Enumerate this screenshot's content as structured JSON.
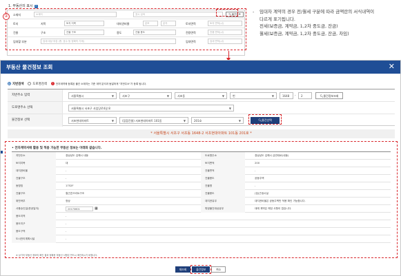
{
  "top_section": {
    "title": "1. 부동산의 표시",
    "help_badge": "?",
    "step_number": "②",
    "rows": [
      {
        "label": "소재지",
        "inputs": [
          "소재지",
          "",
          "표시 검색"
        ],
        "button": "물건정보"
      },
      {
        "label": "토지",
        "sub1": "지목",
        "sel1": "토지 지목",
        "sub2": "대지권비율",
        "inp2a": "분모",
        "inp2b": "분자",
        "sub3": "토지면적",
        "inp3": "토지 면적(㎡)"
      },
      {
        "label": "건물",
        "sub1": "구조",
        "sel1": "건물 구조",
        "sub2": "용도",
        "sel2": "건물 용도",
        "sub3": "전용면적",
        "inp3": "전용 면적(㎡)"
      },
      {
        "label": "임대할 부분",
        "inp1": "임대 대상 부분 (층, 호수 등 정확히 기재)",
        "sub3": "임대면적",
        "inp3": "임대 면적(㎡)"
      }
    ]
  },
  "notes": {
    "dash": "-",
    "line1": "임대차 계약의 경우 전/월세 구분에 따라 금액란의 서식내역이",
    "line2": "다르게 표기됩니다.",
    "line3": "전세(보증금, 계약금, 1,2차 중도금, 잔금)",
    "line4": "월세(보증금, 계약금, 1,2차 중도금, 잔금, 차임)"
  },
  "dialog": {
    "title": "부동산 물건정보 조회",
    "close": "✕",
    "radio_lot": "지번검색",
    "radio_road": "도로명검색",
    "warning_text": "전자계약에 등록된 물건 소재지는 기준 계약 분석과 동일하게 \"지번주소\"가 등록 됩니다.",
    "rows": {
      "lot_label": "지번주소 입력",
      "sido": "서울특별시",
      "gu": "서초구",
      "dong": "서초동",
      "lot_type": "번",
      "bunji1": "1648",
      "bunji2": "2",
      "lot_btn": "물건정보조회",
      "road_label": "도로명주소 선택",
      "road_value": "서울특별시 서초구 사임당로4길 8",
      "item_label": "물건정보 선택",
      "item_name": "서초현대아파트",
      "item_bldg": "(집합건물) 서초현대아파트 101동",
      "item_unit": "201호",
      "item_btn": "물건선택"
    },
    "address_bar": "* 서울특별시 서초구 서초동 1648-2 서초현대아파트 101동 201호 *",
    "info_title": "• 전자계약서에 활용 및 적용 가능한 부동산 정보는 아래와 같습니다.",
    "info_rows": [
      {
        "l1": "지번주소",
        "v1": "경상남도 김해시 내동",
        "l2": "도로명주소",
        "v2": "경상남도 김해시 금관대로(내동)"
      },
      {
        "l1": "토지지목",
        "v1": "대",
        "l2": "토지면적",
        "v2": "200"
      },
      {
        "l1": "대지권비율",
        "v1": "-",
        "l2": "건물면적",
        "v2": "-"
      },
      {
        "l1": "건물구조",
        "v1": "-",
        "l2": "건물용도",
        "v2": "공동주택"
      },
      {
        "l1": "동명칭",
        "v1": "1752F",
        "l2": "건물명",
        "v2": "-"
      },
      {
        "l1": "건물구조",
        "v1": "철근콘크리트구조",
        "l2": "건물용도",
        "v2": "(집)근생시설"
      },
      {
        "l1": "위반여부",
        "v1": "정상",
        "l2": "대지권유무",
        "v2": "대지권비율은 공동주택만 적용 확인 가능합니다."
      },
      {
        "l1": "사용승인일(준공일자)",
        "v1": "20170601",
        "l2": "특정물건대상유무",
        "v2": "대례 계약은 해당 사항이 없습니다."
      },
      {
        "l1": "용도지역",
        "v1": "-",
        "l2": "",
        "v2": ""
      },
      {
        "l1": "용도지구",
        "v1": "-",
        "l2": "",
        "v2": ""
      },
      {
        "l1": "용도구역",
        "v1": "-",
        "l2": "",
        "v2": ""
      },
      {
        "l1": "도시관리계획시설",
        "v1": "-",
        "l2": "",
        "v2": ""
      }
    ],
    "info_footnote": "※ 상기의 부동산 정보의 확인 결과 정확한 부동산 사항은 반드시 확인하시기 바랍니다.",
    "buttons": {
      "recheck": "재조회",
      "confirm": "물건정보",
      "cancel": "취소"
    }
  }
}
